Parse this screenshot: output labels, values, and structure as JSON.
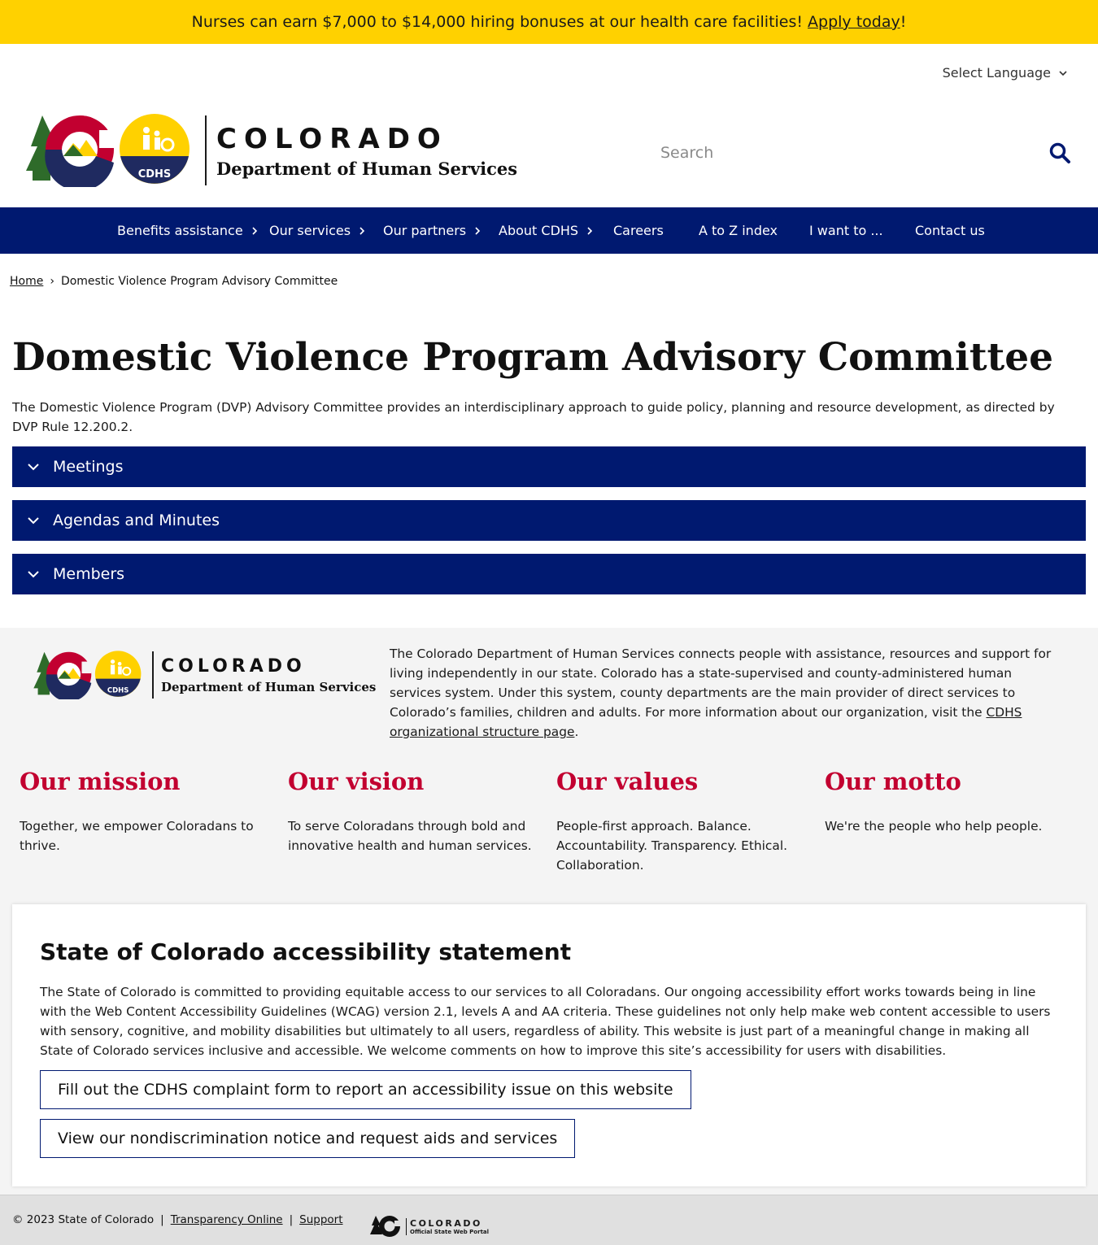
{
  "alert": {
    "text": "Nurses can earn $7,000 to $14,000 hiring bonuses at our health care facilities!",
    "link": "Apply today",
    "suffix": "!"
  },
  "language": {
    "label": "Select Language"
  },
  "header": {
    "co_wordmark": "COLORADO",
    "dept_wordmark": "Department of Human Services",
    "logo_badge": "CDHS",
    "search_placeholder": "Search"
  },
  "nav": {
    "items": [
      {
        "label": "Benefits assistance",
        "has_submenu": true
      },
      {
        "label": "Our services",
        "has_submenu": true
      },
      {
        "label": "Our partners",
        "has_submenu": true
      },
      {
        "label": "About CDHS",
        "has_submenu": true
      },
      {
        "label": "Careers",
        "has_submenu": false
      },
      {
        "label": "A to Z index",
        "has_submenu": false
      },
      {
        "label": "I want to ...",
        "has_submenu": false
      },
      {
        "label": "Contact us",
        "has_submenu": false
      }
    ]
  },
  "breadcrumb": {
    "home": "Home",
    "separator": "›",
    "current": "Domestic Violence Program Advisory Committee"
  },
  "main": {
    "title": "Domestic Violence Program Advisory Committee",
    "intro": "The Domestic Violence Program (DVP) Advisory Committee provides an interdisciplinary approach to guide policy, planning and resource development, as directed by DVP Rule 12.200.2.",
    "accordions": [
      {
        "label": "Meetings"
      },
      {
        "label": "Agendas and Minutes"
      },
      {
        "label": "Members"
      }
    ]
  },
  "footer": {
    "about_text": "The Colorado Department of Human Services connects people with assistance, resources and support for living independently in our state. Colorado has a state-supervised and county-administered human services system. Under this system, county departments are the main provider of direct services to Colorado’s families, children and adults. For more information about our organization, visit the",
    "about_link": "CDHS organizational structure page",
    "about_end": ".",
    "columns": [
      {
        "title": "Our mission",
        "text": "Together, we empower Coloradans to thrive."
      },
      {
        "title": "Our vision",
        "text": "To serve Coloradans through bold and innovative health and human services."
      },
      {
        "title": "Our values",
        "text": "People-first approach. Balance. Accountability. Transparency. Ethical. Collaboration."
      },
      {
        "title": "Our motto",
        "text": "We're the people who help people."
      }
    ],
    "accessibility": {
      "title": "State of Colorado accessibility statement",
      "text": "The State of Colorado is committed to providing equitable access to our services to all Coloradans. Our ongoing accessibility effort works towards being in line with the Web Content Accessibility Guidelines (WCAG) version 2.1, levels A and AA criteria. These guidelines not only help make web content accessible to users with sensory, cognitive, and mobility disabilities but ultimately to all users, regardless of ability. This website is just part of a meaningful change in making all State of Colorado services inclusive and accessible. We welcome comments on how to improve this site’s accessibility for users with disabilities.",
      "button1": "Fill out the CDHS complaint form to report an accessibility issue on this website",
      "button2": "View our nondiscrimination notice and request aids and services"
    }
  },
  "bottom": {
    "copyright": "© 2023 State of Colorado",
    "sep": "|",
    "link1": "Transparency Online",
    "link2": "Support",
    "portal_title": "COLORADO",
    "portal_sub": "Official State Web Portal"
  },
  "colors": {
    "navy": "#001970",
    "gold": "#ffd100",
    "red": "#c20030",
    "footer_bg": "#f4f4f4"
  }
}
